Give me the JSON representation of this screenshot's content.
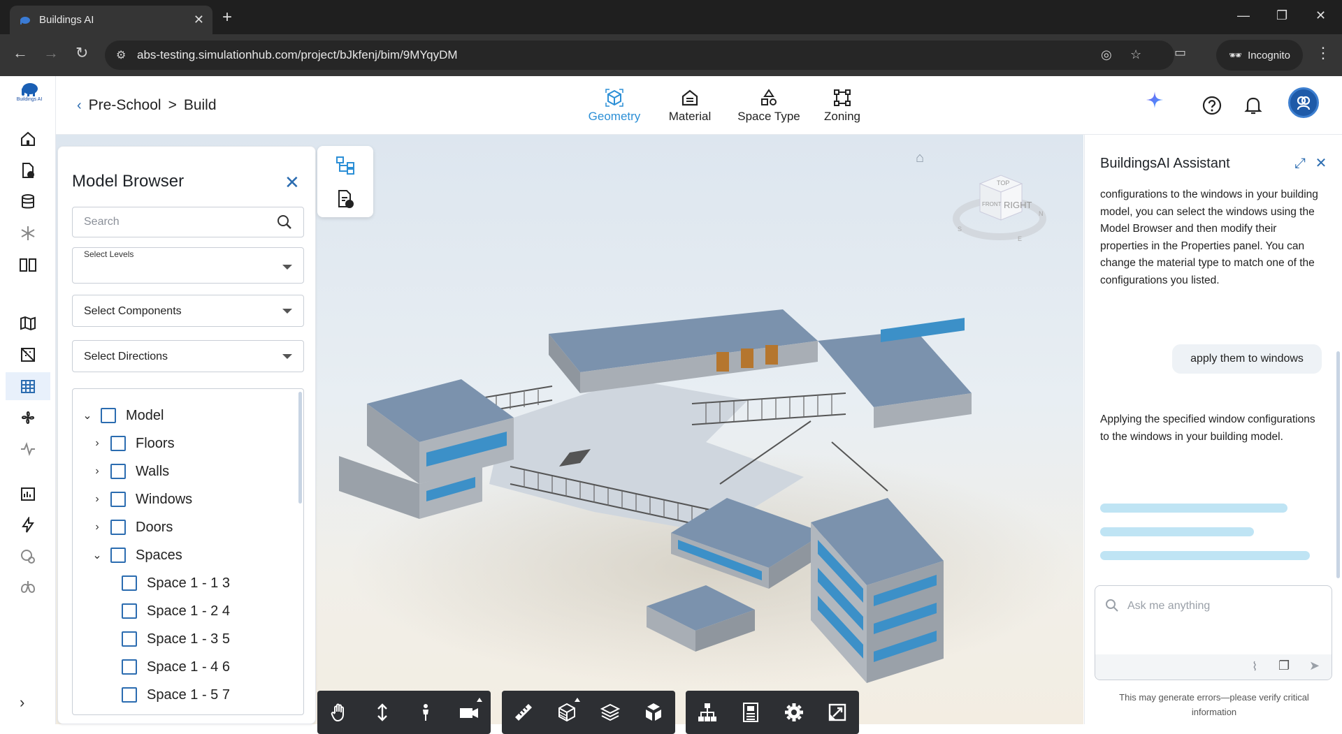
{
  "browser": {
    "tab_title": "Buildings AI",
    "url": "abs-testing.simulationhub.com/project/bJkfenj/bim/9MYqyDM",
    "profile_label": "Incognito"
  },
  "logo": {
    "text": "Buildings AI"
  },
  "breadcrumb": {
    "project": "Pre-School",
    "separator": ">",
    "page": "Build"
  },
  "modes": [
    {
      "label": "Geometry",
      "icon": "cube-icon",
      "active": true
    },
    {
      "label": "Material",
      "icon": "material-icon",
      "active": false
    },
    {
      "label": "Space Type",
      "icon": "space-type-icon",
      "active": false
    },
    {
      "label": "Zoning",
      "icon": "zoning-icon",
      "active": false
    }
  ],
  "model_browser": {
    "title": "Model Browser",
    "search_placeholder": "Search",
    "levels_label": "Select Levels",
    "levels_value": "",
    "components_label": "Select Components",
    "directions_label": "Select Directions",
    "tree": [
      {
        "label": "Model",
        "expanded": true,
        "level": 0
      },
      {
        "label": "Floors",
        "expanded": false,
        "level": 1
      },
      {
        "label": "Walls",
        "expanded": false,
        "level": 1
      },
      {
        "label": "Windows",
        "expanded": false,
        "level": 1
      },
      {
        "label": "Doors",
        "expanded": false,
        "level": 1
      },
      {
        "label": "Spaces",
        "expanded": true,
        "level": 1
      },
      {
        "label": "Space 1 - 1 3",
        "level": 2
      },
      {
        "label": "Space 1 - 2 4",
        "level": 2
      },
      {
        "label": "Space 1 - 3 5",
        "level": 2
      },
      {
        "label": "Space 1 - 4 6",
        "level": 2
      },
      {
        "label": "Space 1 - 5 7",
        "level": 2
      }
    ]
  },
  "viewcube": {
    "top": "TOP",
    "front": "FRONT",
    "right": "RIGHT",
    "n": "N",
    "s": "S",
    "e": "E"
  },
  "assistant": {
    "title": "BuildingsAI Assistant",
    "message_1": "configurations to the windows in your building model, you can select the windows using the Model Browser and then modify their properties in the Properties panel. You can change the material type to match one of the configurations you listed.",
    "user_message": "apply them to windows",
    "message_2": "Applying the specified window configurations to the windows in your building model.",
    "input_placeholder": "Ask me anything",
    "disclaimer": "This may generate errors—please verify critical information"
  },
  "colors": {
    "accent": "#2c8fd6",
    "primary": "#2b6cb0",
    "toolbar": "#2d2f33"
  }
}
